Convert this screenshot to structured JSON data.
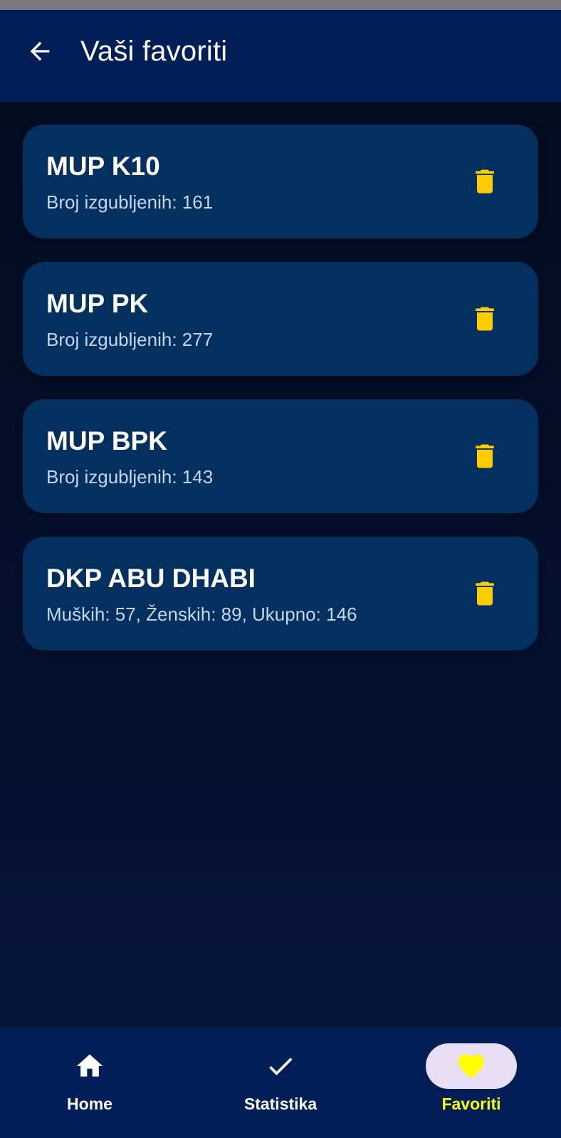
{
  "app_bar": {
    "title": "Vaši favoriti",
    "back_icon": "arrow-left-icon"
  },
  "favorites": [
    {
      "title": "MUP K10",
      "subtitle": "Broj izgubljenih: 161"
    },
    {
      "title": "MUP PK",
      "subtitle": "Broj izgubljenih: 277"
    },
    {
      "title": "MUP BPK",
      "subtitle": "Broj izgubljenih: 143"
    },
    {
      "title": "DKP ABU DHABI",
      "subtitle": "Muških: 57, Ženskih: 89, Ukupno: 146"
    }
  ],
  "bottom_nav": {
    "items": [
      {
        "label": "Home",
        "icon": "home-icon",
        "active": false
      },
      {
        "label": "Statistika",
        "icon": "check-icon",
        "active": false
      },
      {
        "label": "Favoriti",
        "icon": "heart-icon",
        "active": true
      }
    ]
  },
  "colors": {
    "app_bar": "#011e57",
    "card": "#03305f",
    "delete_icon": "#ffcc00",
    "active_nav_label": "#ffff00",
    "active_nav_pill": "#e8dff6"
  }
}
